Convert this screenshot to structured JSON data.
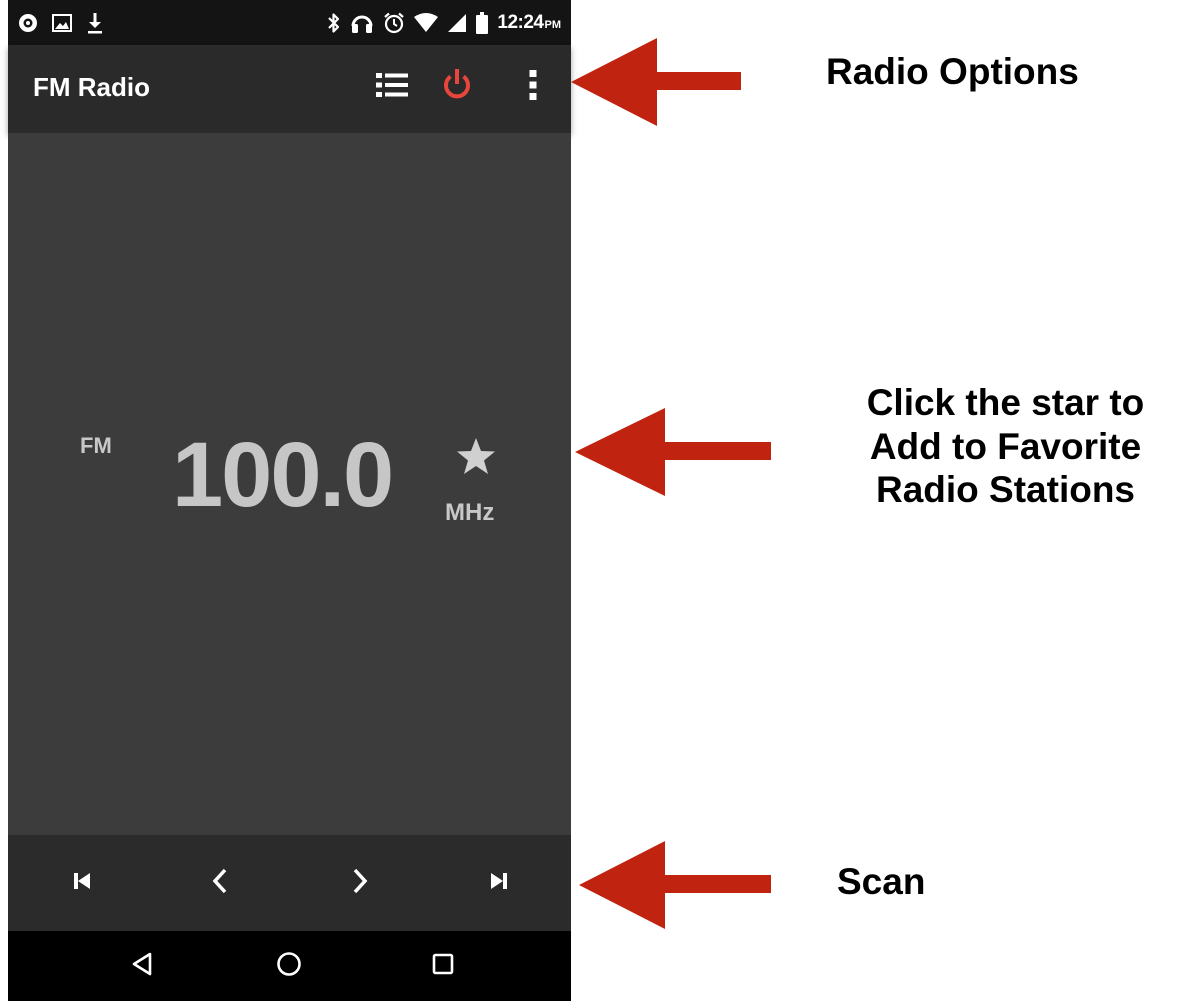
{
  "status_bar": {
    "left_icons": [
      "notification-icon",
      "image-icon",
      "download-icon"
    ],
    "right_icons": [
      "bluetooth-icon",
      "headphones-icon",
      "alarm-icon",
      "wifi-icon",
      "signal-icon",
      "battery-icon"
    ],
    "time": "12:24",
    "ampm": "PM"
  },
  "app_bar": {
    "title": "FM Radio",
    "actions": [
      "station-list-icon",
      "power-icon",
      "more-options-icon"
    ],
    "power_color": "#e8453c"
  },
  "tuner": {
    "band": "FM",
    "frequency": "100.0",
    "unit": "MHz",
    "favorite_icon": "star-icon"
  },
  "controls": [
    "skip-previous-icon",
    "chevron-left-icon",
    "chevron-right-icon",
    "skip-next-icon"
  ],
  "navigation": [
    "back-icon",
    "home-icon",
    "recents-icon"
  ],
  "annotations": {
    "radio_options": "Radio Options",
    "favorite_line1": "Click the star to",
    "favorite_line2": "Add to Favorite",
    "favorite_line3": "Radio Stations",
    "scan": "Scan",
    "arrow_color": "#c0230f"
  }
}
